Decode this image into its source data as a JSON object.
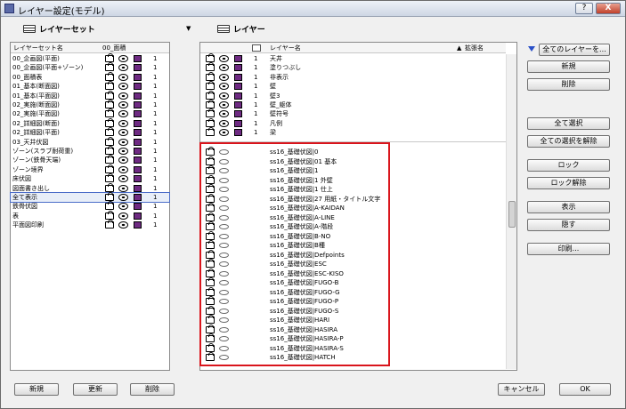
{
  "window": {
    "title": "レイヤー設定(モデル)",
    "help": "?",
    "close": "X"
  },
  "left": {
    "header": "レイヤーセット",
    "col_name": "レイヤーセット名",
    "col_set": "00_面積",
    "items": [
      "00_企画図(平面)",
      "00_企画図(平面+ゾーン)",
      "00_面積表",
      "01_基本(断面図)",
      "01_基本(平面図)",
      "02_実施(断面図)",
      "02_実施(平面図)",
      "02_詳細図(断面)",
      "02_詳細図(平面)",
      "03_天井伏図",
      "ゾーン(スラブ耐荷重)",
      "ゾーン(鉄骨天端)",
      "ゾーン境界",
      "床伏図",
      "図面書き出し",
      "全て表示",
      "鉄骨伏図",
      "表",
      "平面図印刷"
    ],
    "count": "1",
    "buttons": {
      "new": "新規",
      "update": "更新",
      "delete": "削除"
    }
  },
  "right": {
    "header": "レイヤー",
    "col_name": "レイヤー名",
    "col_ext": "拡張名",
    "top_layers": [
      "天井",
      "塗りつぶし",
      "非表示",
      "壁",
      "壁3",
      "壁_躯体",
      "壁符号",
      "凡例",
      "梁"
    ],
    "count": "1",
    "hidden_layers": [
      "ss16_基礎伏図|0",
      "ss16_基礎伏図|01 基本",
      "ss16_基礎伏図|1",
      "ss16_基礎伏図|1 外壁",
      "ss16_基礎伏図|1 仕上",
      "ss16_基礎伏図|27 用紙・タイトル文字",
      "ss16_基礎伏図|A-KAIDAN",
      "ss16_基礎伏図|A-LINE",
      "ss16_基礎伏図|A-階段",
      "ss16_基礎伏図|B-NO",
      "ss16_基礎伏図|B種",
      "ss16_基礎伏図|Defpoints",
      "ss16_基礎伏図|ESC",
      "ss16_基礎伏図|ESC-KISO",
      "ss16_基礎伏図|FUGO-B",
      "ss16_基礎伏図|FUGO-G",
      "ss16_基礎伏図|FUGO-P",
      "ss16_基礎伏図|FUGO-S",
      "ss16_基礎伏図|HARI",
      "ss16_基礎伏図|HASIRA",
      "ss16_基礎伏図|HASIRA-P",
      "ss16_基礎伏図|HASIRA-S",
      "ss16_基礎伏図|HATCH"
    ]
  },
  "side_buttons": {
    "all_layers": "全てのレイヤーを...",
    "new": "新規",
    "delete": "削除",
    "select_all": "全て選択",
    "deselect_all": "全ての選択を解除",
    "lock": "ロック",
    "unlock": "ロック解除",
    "show": "表示",
    "hide": "隠す",
    "print": "印刷..."
  },
  "footer": {
    "cancel": "キャンセル",
    "ok": "OK"
  },
  "colors": {
    "highlight": "#d9151c",
    "wire": "#6e2a82"
  }
}
